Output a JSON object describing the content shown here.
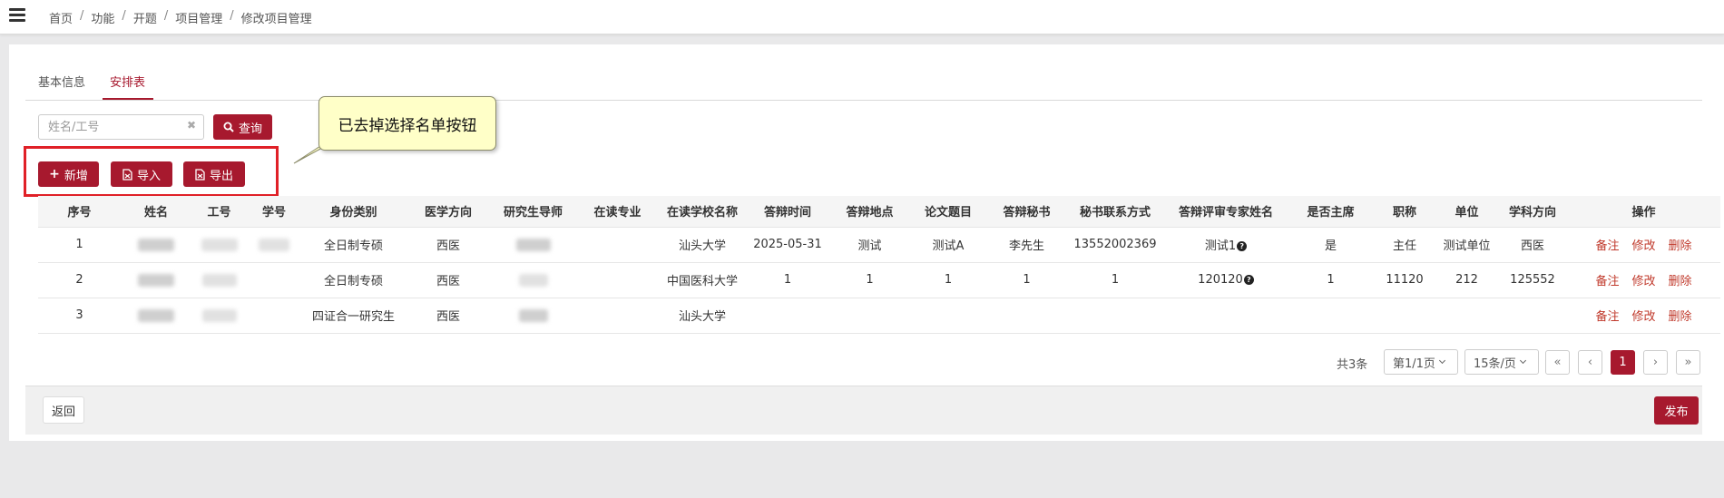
{
  "breadcrumb": [
    "首页",
    "功能",
    "开题",
    "项目管理",
    "修改项目管理"
  ],
  "tabs": [
    {
      "label": "基本信息",
      "active": false
    },
    {
      "label": "安排表",
      "active": true
    }
  ],
  "search": {
    "placeholder": "姓名/工号",
    "value": "",
    "button_label": "查询"
  },
  "toolbar": {
    "add_label": "新增",
    "import_label": "导入",
    "export_label": "导出"
  },
  "callout": {
    "text": "已去掉选择名单按钮"
  },
  "table": {
    "headers": [
      "序号",
      "姓名",
      "工号",
      "学号",
      "身份类别",
      "医学方向",
      "研究生导师",
      "在读专业",
      "在读学校名称",
      "答辩时间",
      "答辩地点",
      "论文题目",
      "答辩秘书",
      "秘书联系方式",
      "答辩评审专家姓名",
      "是否主席",
      "职称",
      "单位",
      "学科方向",
      "操作"
    ],
    "rows": [
      {
        "no": "1",
        "identity": "全日制专硕",
        "direction": "西医",
        "major": "",
        "school": "汕头大学",
        "defense_time": "2025-05-31",
        "defense_place": "测试",
        "thesis": "测试A",
        "secretary": "李先生",
        "secretary_phone": "13552002369",
        "experts": "测试1",
        "is_chair": "是",
        "title": "主任",
        "unit": "测试单位",
        "subject": "西医"
      },
      {
        "no": "2",
        "identity": "全日制专硕",
        "direction": "西医",
        "major": "",
        "school": "中国医科大学",
        "defense_time": "1",
        "defense_place": "1",
        "thesis": "1",
        "secretary": "1",
        "secretary_phone": "1",
        "experts": "120120",
        "is_chair": "1",
        "title": "11120",
        "unit": "212",
        "subject": "125552"
      },
      {
        "no": "3",
        "identity": "四证合一研究生",
        "direction": "西医",
        "major": "",
        "school": "汕头大学",
        "defense_time": "",
        "defense_place": "",
        "thesis": "",
        "secretary": "",
        "secretary_phone": "",
        "experts": "",
        "is_chair": "",
        "title": "",
        "unit": "",
        "subject": ""
      }
    ],
    "actions": [
      "备注",
      "修改",
      "删除"
    ]
  },
  "pagination": {
    "total": "共3条",
    "page_select": "第1/1页",
    "size_select": "15条/页",
    "first": "«",
    "prev": "‹",
    "current": "1",
    "next": "›",
    "last": "»"
  },
  "footer": {
    "back_label": "返回",
    "publish_label": "发布"
  },
  "colors": {
    "brand": "#a7192e",
    "highlight": "#e02027",
    "callout_bg": "#ffffc8"
  }
}
